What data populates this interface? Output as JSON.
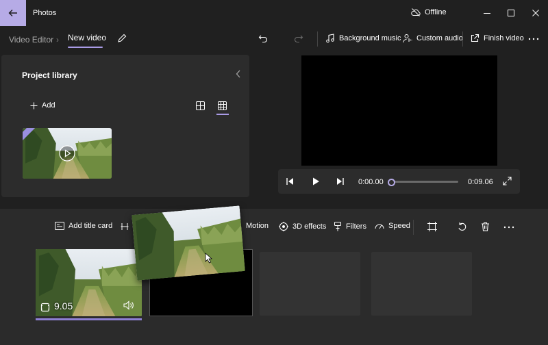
{
  "titlebar": {
    "app_title": "Photos",
    "offline_label": "Offline"
  },
  "toolbar": {
    "breadcrumb_root": "Video Editor",
    "breadcrumb_sep": "›",
    "breadcrumb_current": "New video",
    "background_music": "Background music",
    "custom_audio": "Custom audio",
    "finish_video": "Finish video"
  },
  "library": {
    "title": "Project library",
    "add_label": "Add"
  },
  "player": {
    "current_time": "0:00.00",
    "total_time": "0:09.06",
    "progress": 0
  },
  "storyboard": {
    "add_title_card": "Add title card",
    "motion": "Motion",
    "effects_3d": "3D effects",
    "filters": "Filters",
    "speed": "Speed",
    "clip_duration": "9.05"
  },
  "colors": {
    "accent": "#b6abe6",
    "accent_bar": "#8e80d4"
  }
}
